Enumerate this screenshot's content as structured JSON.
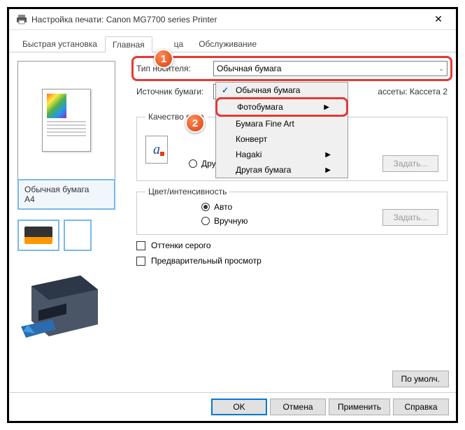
{
  "window": {
    "title": "Настройка печати: Canon MG7700 series Printer"
  },
  "tabs": {
    "quick": "Быстрая установка",
    "main": "Главная",
    "page": "ца",
    "maint": "Обслуживание"
  },
  "preview": {
    "media": "Обычная бумага",
    "size": "A4"
  },
  "fields": {
    "media_label": "Тип носителя:",
    "media_value": "Обычная бумага",
    "source_label": "Источник бумаги:",
    "cassette_tail": "ассеты: Кассета 2"
  },
  "dropdown": {
    "items": [
      "Обычная бумага",
      "Фотобумага",
      "Бумага Fine Art",
      "Конверт",
      "Hagaki",
      "Другая бумага"
    ]
  },
  "quality": {
    "legend": "Качество печа",
    "other": "Другое",
    "set_btn": "Задать..."
  },
  "color": {
    "legend": "Цвет/интенсивность",
    "auto": "Авто",
    "manual": "Вручную",
    "set_btn": "Задать..."
  },
  "checks": {
    "grayscale": "Оттенки серого",
    "preview": "Предварительный просмотр"
  },
  "defaults_btn": "По умолч.",
  "footer": {
    "ok": "OK",
    "cancel": "Отмена",
    "apply": "Применить",
    "help": "Справка"
  },
  "callouts": {
    "one": "1",
    "two": "2"
  }
}
